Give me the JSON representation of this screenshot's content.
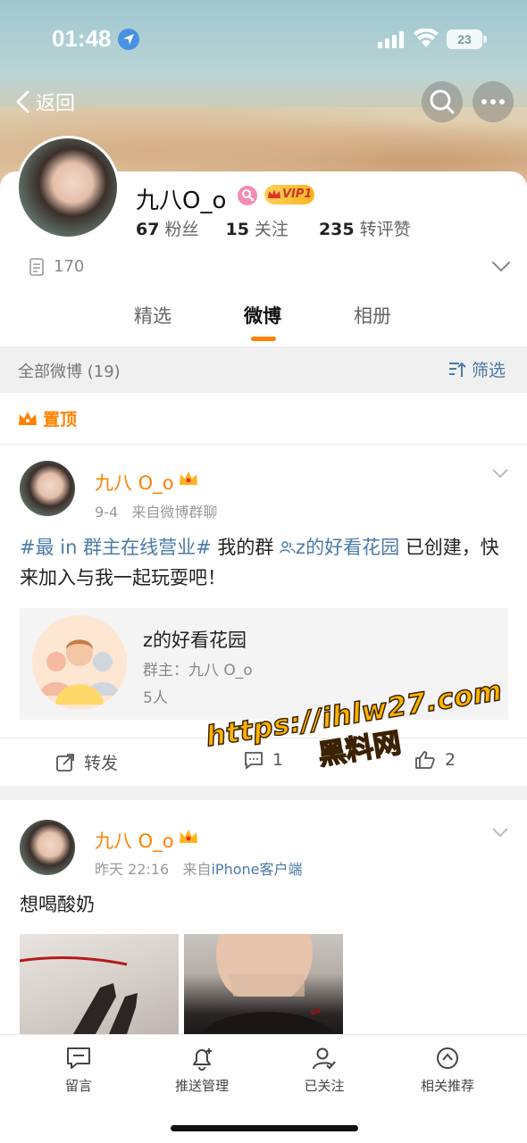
{
  "status_bar": {
    "time": "01:48",
    "battery": "23"
  },
  "nav": {
    "back_label": "返回"
  },
  "profile": {
    "username": "九八O_o",
    "vip_label": "VIP1",
    "stats": [
      {
        "value": "67",
        "label": "粉丝"
      },
      {
        "value": "15",
        "label": "关注"
      },
      {
        "value": "235",
        "label": "转评赞"
      }
    ],
    "doc_count": "170"
  },
  "tabs": [
    {
      "label": "精选",
      "active": false
    },
    {
      "label": "微博",
      "active": true
    },
    {
      "label": "相册",
      "active": false
    }
  ],
  "filter_bar": {
    "count_label": "全部微博 (19)",
    "filter_label": "筛选"
  },
  "pinned_label": "置顶",
  "posts": [
    {
      "author": "九八 O_o",
      "date": "9-4",
      "source_prefix": "来自",
      "source": "微博群聊",
      "hashtag": "#最 in 群主在线营业#",
      "text_before": " 我的群 ",
      "group_link": "z的好看花园",
      "text_after": " 已创建，快来加入与我一起玩耍吧！",
      "group_card": {
        "name": "z的好看花园",
        "owner": "群主：九八 O_o",
        "members": "5人"
      },
      "actions": {
        "repost_label": "转发",
        "comment_count": "1",
        "like_count": "2"
      }
    },
    {
      "author": "九八 O_o",
      "date": "昨天 22:16",
      "source_prefix": "来自",
      "source": "iPhone客户端",
      "text": "想喝酸奶"
    }
  ],
  "watermark": {
    "url": "https://ihlw27.com",
    "site": "黑料网"
  },
  "bottom_bar": [
    {
      "label": "留言",
      "icon": "message-icon"
    },
    {
      "label": "推送管理",
      "icon": "bell-plus-icon"
    },
    {
      "label": "已关注",
      "icon": "user-check-icon"
    },
    {
      "label": "相关推荐",
      "icon": "compass-icon"
    }
  ],
  "colors": {
    "accent": "#ff8200",
    "link": "#4a7aa7"
  }
}
